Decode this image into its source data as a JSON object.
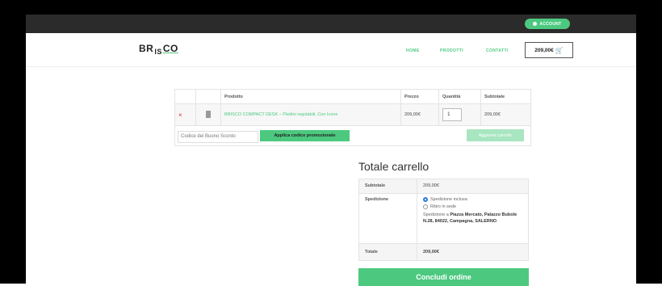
{
  "topbar": {
    "account_label": "ACCOUNT"
  },
  "header": {
    "logo": {
      "part1": "BR",
      "part2": "IS",
      "part3": "CO"
    },
    "nav": [
      {
        "label": "HOME"
      },
      {
        "label": "PRODOTTI"
      },
      {
        "label": "CONTATTI"
      }
    ],
    "cart_total": "209,00€"
  },
  "cart_table": {
    "headers": [
      "",
      "",
      "Prodotto",
      "Prezzo",
      "Quantità",
      "Subtotale"
    ],
    "rows": [
      {
        "remove": "×",
        "product": "BRISCO COMPACT DESK – Piedini regolabili, Con Icone",
        "price": "209,00€",
        "quantity": "1",
        "subtotal": "209,00€"
      }
    ]
  },
  "coupon": {
    "placeholder": "Codice del Buono Sconto",
    "apply_label": "Applica codice promozionale",
    "update_label": "Aggiorna carrello"
  },
  "totals": {
    "title": "Totale carrello",
    "subtotal_label": "Subtotale",
    "subtotal_value": "209,00€",
    "shipping_label": "Spedizione",
    "shipping_options": [
      {
        "label": "Spedizione inclusa",
        "selected": true
      },
      {
        "label": "Ritiro in sede",
        "selected": false
      }
    ],
    "shipping_note_prefix": "Spedizione a ",
    "shipping_address": "Piazza Mercato, Palazzo Bubole N.28, 84022, Campagna, SALERNO",
    "shipping_note_suffix": ".",
    "total_label": "Totale",
    "total_value": "209,00€"
  },
  "checkout_label": "Concludi ordine",
  "colors": {
    "accent": "#4cc97f",
    "topbar": "#2b2b2b",
    "remove": "#e03030"
  }
}
